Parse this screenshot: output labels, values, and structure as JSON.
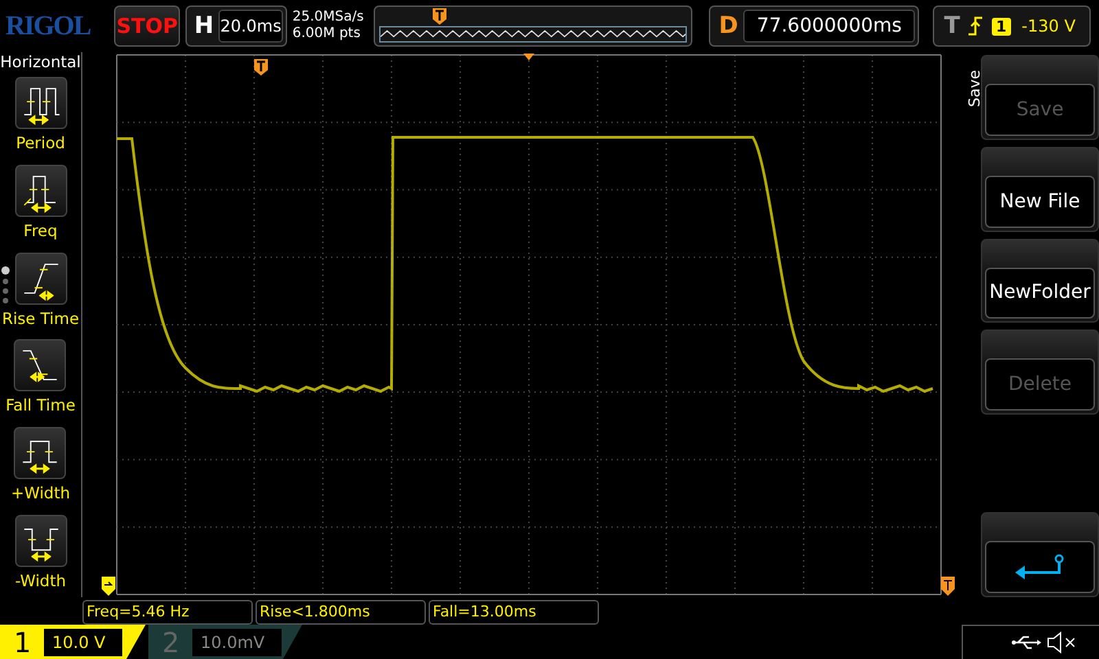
{
  "header": {
    "logo": "RIGOL",
    "run_state": "STOP",
    "horizontal": {
      "label": "H",
      "value": "20.0ms"
    },
    "sample_rate": "25.0MSa/s",
    "memory_depth": "6.00M pts",
    "delay": {
      "label": "D",
      "value": "77.6000000ms"
    },
    "trigger": {
      "label": "T",
      "source": "1",
      "level": "-130 V"
    }
  },
  "left_menu": {
    "title": "Horizontal",
    "items": [
      {
        "label": "Period",
        "kind": "period"
      },
      {
        "label": "Freq",
        "kind": "freq"
      },
      {
        "label": "Rise Time",
        "kind": "rise"
      },
      {
        "label": "Fall Time",
        "kind": "fall"
      },
      {
        "label": "+Width",
        "kind": "pwidth"
      },
      {
        "label": "-Width",
        "kind": "nwidth"
      }
    ],
    "pages": [
      {
        "selected": true
      },
      {
        "selected": false
      },
      {
        "selected": false
      },
      {
        "selected": false
      }
    ]
  },
  "measurements": [
    "Freq=5.46 Hz",
    "Rise<1.800ms",
    "Fall=13.00ms"
  ],
  "channels": [
    {
      "label": "1",
      "scale": "10.0 V",
      "on": true
    },
    {
      "label": "2",
      "scale": "10.0mV",
      "on": false
    }
  ],
  "right_menu": {
    "title": "Save",
    "buttons": [
      {
        "kind": "text",
        "label": "Save",
        "disabled": true
      },
      {
        "kind": "text",
        "label": "New File",
        "disabled": false
      },
      {
        "kind": "text",
        "label": "NewFolder",
        "disabled": false
      },
      {
        "kind": "text",
        "label": "Delete",
        "disabled": true
      },
      {
        "kind": "back"
      }
    ]
  }
}
